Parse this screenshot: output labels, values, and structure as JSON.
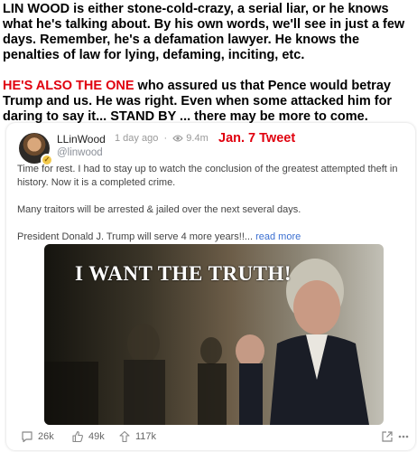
{
  "commentary": {
    "paragraph1": "LIN WOOD is either stone-cold-crazy, a serial liar, or he knows what he's talking about. By his own words, we'll see in just a few days.  Remember, he's a defamation lawyer. He knows the penalties of law for lying, defaming, inciting, etc.",
    "paragraph2_lead": "HE'S ALSO THE ONE",
    "paragraph2_rest": " who assured us that Pence would betray Trump and us.  He was right. Even when some attacked him for daring to say it...  STAND BY ... there may be more to come.",
    "lead_color": "#e0000e"
  },
  "post": {
    "author": "LLinWood",
    "handle": "@linwood",
    "time": "1 day ago",
    "views": "9.4m",
    "annotation": "Jan. 7 Tweet",
    "text_line1": "Time for rest. I had to stay up to watch the conclusion of the greatest attempted theft in history. Now it is a completed crime.",
    "text_line2": "Many traitors will be arrested & jailed over the next several days.",
    "text_line3": "President Donald J. Trump will serve 4 more years!!...",
    "read_more": "read more",
    "media_caption": "I WANT THE TRUTH!"
  },
  "actions": {
    "comments": "26k",
    "likes": "49k",
    "reposts": "117k"
  },
  "icons": [
    "eye-icon",
    "comment-icon",
    "like-icon",
    "repost-icon",
    "share-icon",
    "more-icon",
    "verified-badge-icon"
  ]
}
